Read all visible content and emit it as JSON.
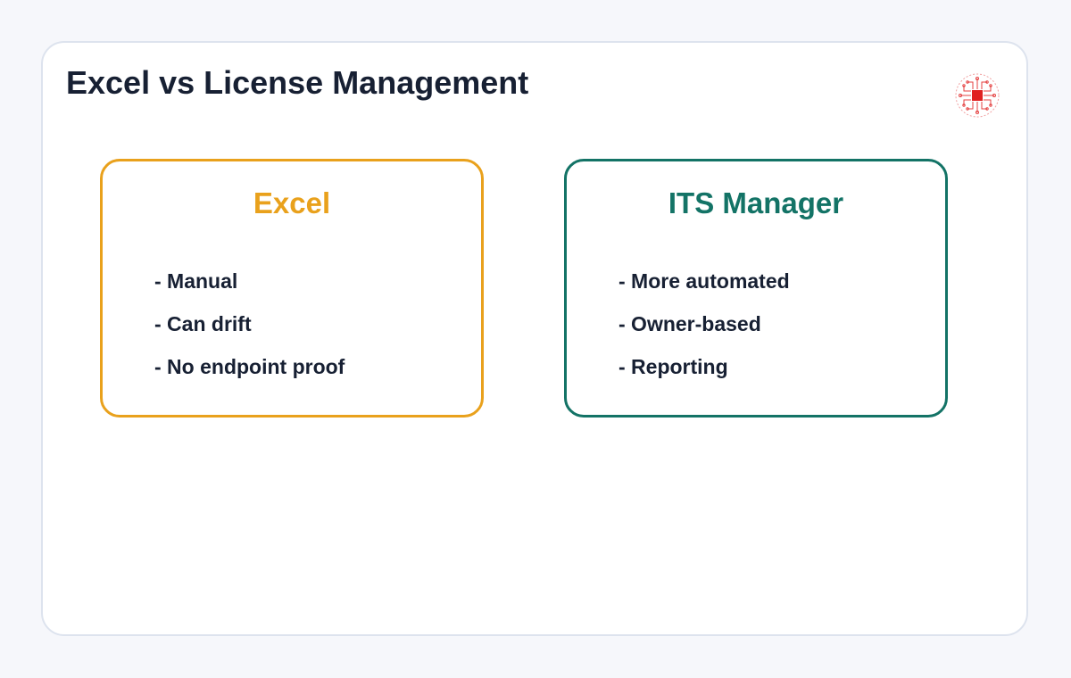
{
  "title": "Excel vs License Management",
  "logo": {
    "icon": "circuit-chip-icon",
    "accent": "#e02020"
  },
  "panels": [
    {
      "title": "Excel",
      "color": "#e9a11c",
      "items": [
        "- Manual",
        "- Can drift",
        "- No endpoint proof"
      ]
    },
    {
      "title": "ITS Manager",
      "color": "#137366",
      "items": [
        "- More automated",
        "- Owner-based",
        "- Reporting"
      ]
    }
  ]
}
